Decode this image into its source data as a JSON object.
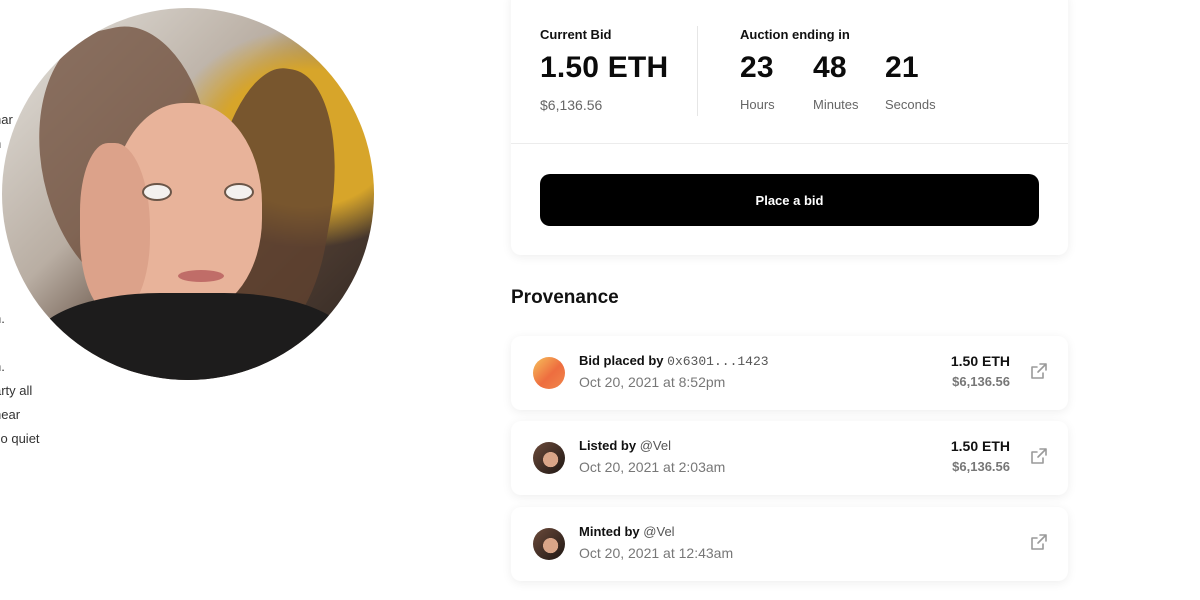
{
  "description": {
    "lines": [
      "har",
      "n",
      "",
      "n.",
      "n.",
      "arty all",
      "hear",
      "so quiet"
    ]
  },
  "avatar": {
    "alt": "profile photo"
  },
  "auction": {
    "current_bid_label": "Current Bid",
    "current_bid_eth": "1.50 ETH",
    "current_bid_usd": "$6,136.56",
    "ending_label": "Auction ending in",
    "hours": "23",
    "hours_label": "Hours",
    "minutes": "48",
    "minutes_label": "Minutes",
    "seconds": "21",
    "seconds_label": "Seconds",
    "place_bid_label": "Place a bid"
  },
  "provenance": {
    "title": "Provenance",
    "items": [
      {
        "action": "Bid placed by",
        "actor": "0x6301...1423",
        "date": "Oct 20, 2021 at 8:52pm",
        "eth": "1.50 ETH",
        "usd": "$6,136.56",
        "icon": "gradient-dot"
      },
      {
        "action": "Listed by",
        "actor": "@Vel",
        "date": "Oct 20, 2021 at 2:03am",
        "eth": "1.50 ETH",
        "usd": "$6,136.56",
        "icon": "avatar-photo"
      },
      {
        "action": "Minted by",
        "actor": "@Vel",
        "date": "Oct 20, 2021 at 12:43am",
        "eth": "",
        "usd": "",
        "icon": "avatar-photo"
      }
    ]
  },
  "colors": {
    "button_bg": "#000000",
    "button_text": "#ffffff",
    "muted_text": "#666666"
  },
  "icons": {
    "external_link": "external-link-icon"
  }
}
